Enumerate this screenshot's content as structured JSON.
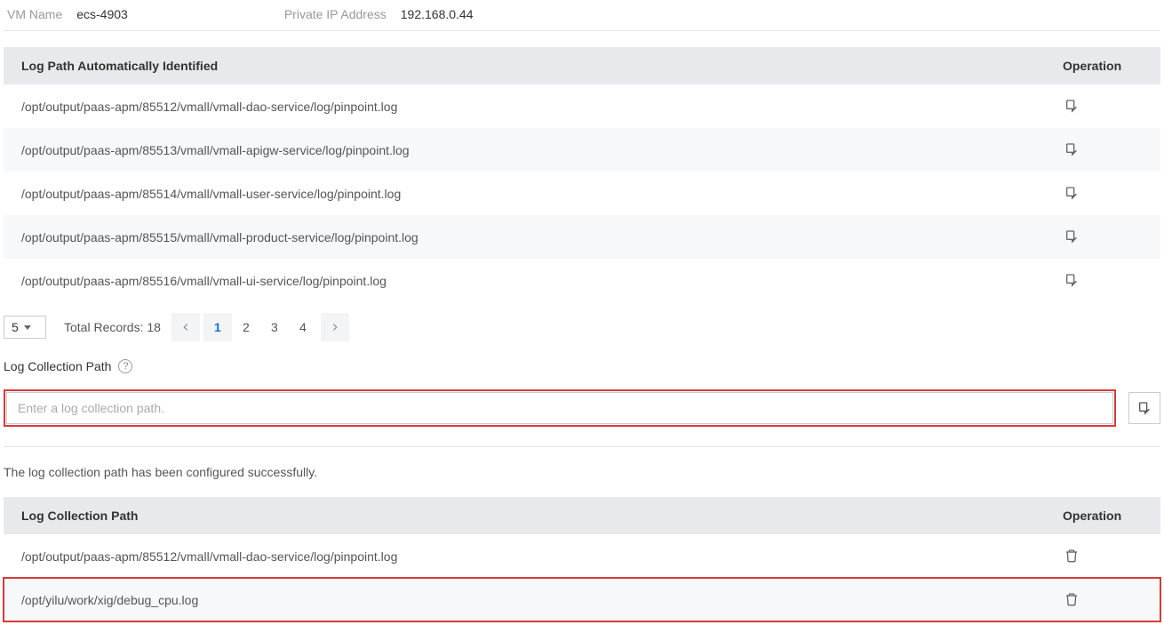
{
  "info": {
    "vm_name_label": "VM Name",
    "vm_name_value": "ecs-4903",
    "ip_label": "Private IP Address",
    "ip_value": "192.168.0.44"
  },
  "table1": {
    "header_path": "Log Path Automatically Identified",
    "header_op": "Operation",
    "rows": [
      {
        "path": "/opt/output/paas-apm/85512/vmall/vmall-dao-service/log/pinpoint.log"
      },
      {
        "path": "/opt/output/paas-apm/85513/vmall/vmall-apigw-service/log/pinpoint.log"
      },
      {
        "path": "/opt/output/paas-apm/85514/vmall/vmall-user-service/log/pinpoint.log"
      },
      {
        "path": "/opt/output/paas-apm/85515/vmall/vmall-product-service/log/pinpoint.log"
      },
      {
        "path": "/opt/output/paas-apm/85516/vmall/vmall-ui-service/log/pinpoint.log"
      }
    ]
  },
  "pagination": {
    "page_size": "5",
    "total_label": "Total Records: 18",
    "pages": [
      "1",
      "2",
      "3",
      "4"
    ],
    "active_page": "1"
  },
  "collection": {
    "label": "Log Collection Path",
    "help": "?",
    "input_placeholder": "Enter a log collection path.",
    "status_msg": "The log collection path has been configured successfully."
  },
  "table2": {
    "header_path": "Log Collection Path",
    "header_op": "Operation",
    "rows": [
      {
        "path": "/opt/output/paas-apm/85512/vmall/vmall-dao-service/log/pinpoint.log",
        "highlight": false
      },
      {
        "path": "/opt/yilu/work/xig/debug_cpu.log",
        "highlight": true
      }
    ]
  }
}
